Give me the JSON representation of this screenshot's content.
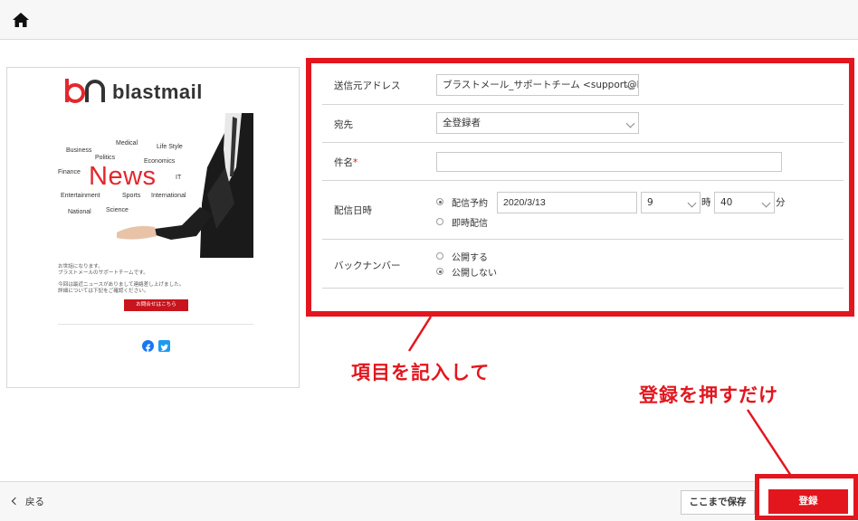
{
  "nav": {
    "home_icon": "home-icon"
  },
  "preview": {
    "brand": "blastmail",
    "hero_words": [
      "Medical",
      "Business",
      "Life Style",
      "Politics",
      "Economics",
      "Finance",
      "IT",
      "Entertainment",
      "Sports",
      "International",
      "National",
      "Science"
    ],
    "hero_headline": "News",
    "body_lines": [
      "お世話になります。",
      "ブラストメールのサポートチームです。",
      "今回は最近ニュースがありまして連絡差し上げました。",
      "詳細については下記をご確認ください。"
    ],
    "cta_label": "お問合せはこちら",
    "social_icons": [
      "facebook-icon",
      "twitter-icon"
    ]
  },
  "form": {
    "sender": {
      "label": "送信元アドレス",
      "value": "ブラストメール_サポートチーム <support@b"
    },
    "recipient": {
      "label": "宛先",
      "value": "全登録者"
    },
    "subject": {
      "label": "件名",
      "required_mark": "*",
      "value": ""
    },
    "schedule": {
      "label": "配信日時",
      "option_scheduled": "配信予約",
      "option_immediate": "即時配信",
      "selected": "配信予約",
      "date": "2020/3/13",
      "hour": "9",
      "hour_unit": "時",
      "minute": "40",
      "minute_unit": "分"
    },
    "backnumber": {
      "label": "バックナンバー",
      "option_public": "公開する",
      "option_private": "公開しない",
      "selected": "公開しない"
    }
  },
  "annotations": {
    "fill_items": "項目を記入して",
    "press_register": "登録を押すだけ",
    "color": "#e3161e"
  },
  "footer": {
    "back_label": "戻る",
    "save_label": "ここまで保存",
    "register_label": "登録"
  }
}
